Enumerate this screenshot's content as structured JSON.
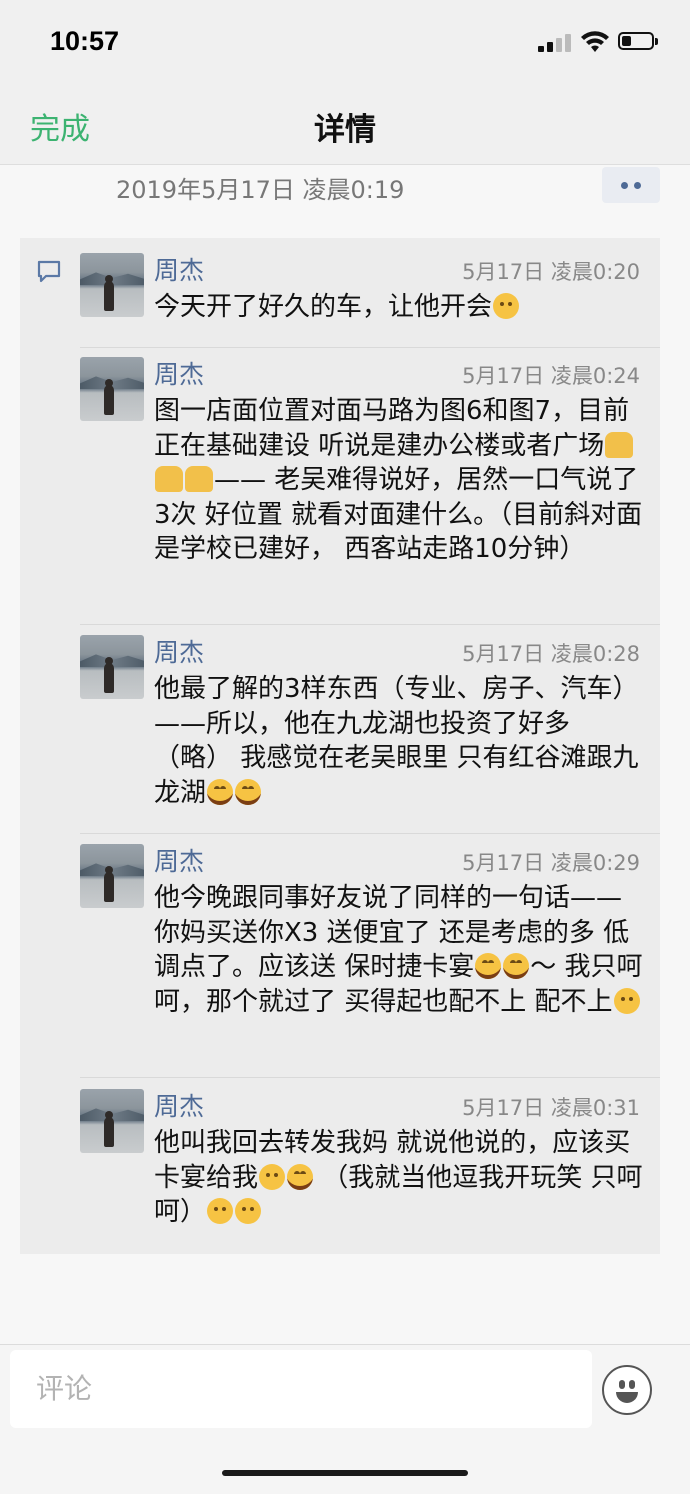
{
  "status_bar": {
    "time": "10:57"
  },
  "nav": {
    "done_label": "完成",
    "title": "详情"
  },
  "post": {
    "time": "2019年5月17日 凌晨0:19"
  },
  "comments": [
    {
      "name": "周杰",
      "time": "5月17日 凌晨0:20",
      "text": "今天开了好久的车，让他开会",
      "emojis": [
        "sleepy-face-emoji"
      ]
    },
    {
      "name": "周杰",
      "time": "5月17日 凌晨0:24",
      "text_1": "图一店面位置对面马路为图6和图7，目前正在基础建设 听说是建办公楼或者广场",
      "text_2": "—— 老吴难得说好，居然一口气说了3次 好位置 就看对面建什么。（目前斜对面是学校已建好， 西客站走路10分钟）",
      "emojis": [
        "folded-hands-emoji",
        "folded-hands-emoji",
        "pointing-hand-emoji"
      ]
    },
    {
      "name": "周杰",
      "time": "5月17日 凌晨0:28",
      "text": "他最了解的3样东西（专业、房子、汽车）——所以，他在九龙湖也投资了好多（略）  我感觉在老吴眼里 只有红谷滩跟九龙湖",
      "emojis": [
        "crying-laughing-emoji",
        "crying-laughing-emoji"
      ]
    },
    {
      "name": "周杰",
      "time": "5月17日 凌晨0:29",
      "text_1": "他今晚跟同事好友说了同样的一句话——你妈买送你X3 送便宜了  还是考虑的多 低调点了。应该送 保时捷卡宴",
      "text_2": "～  我只呵呵，那个就过了  买得起也配不上 配不上",
      "emojis_1": [
        "crying-laughing-emoji",
        "crying-laughing-emoji"
      ],
      "emojis_2": [
        "smiling-face-emoji"
      ]
    },
    {
      "name": "周杰",
      "time": "5月17日 凌晨0:31",
      "text_1": "他叫我回去转发我妈 就说他说的，应该买卡宴给我",
      "text_2": "  （我就当他逗我开玩笑 只呵呵）",
      "emojis_1": [
        "thinking-face-emoji",
        "crying-laughing-emoji"
      ],
      "emojis_2": [
        "thinking-face-emoji",
        "smiling-face-emoji"
      ]
    }
  ],
  "comment_bar": {
    "placeholder": "评论"
  },
  "colors": {
    "accent_green": "#3cb371",
    "name_blue": "#4e6a96"
  }
}
